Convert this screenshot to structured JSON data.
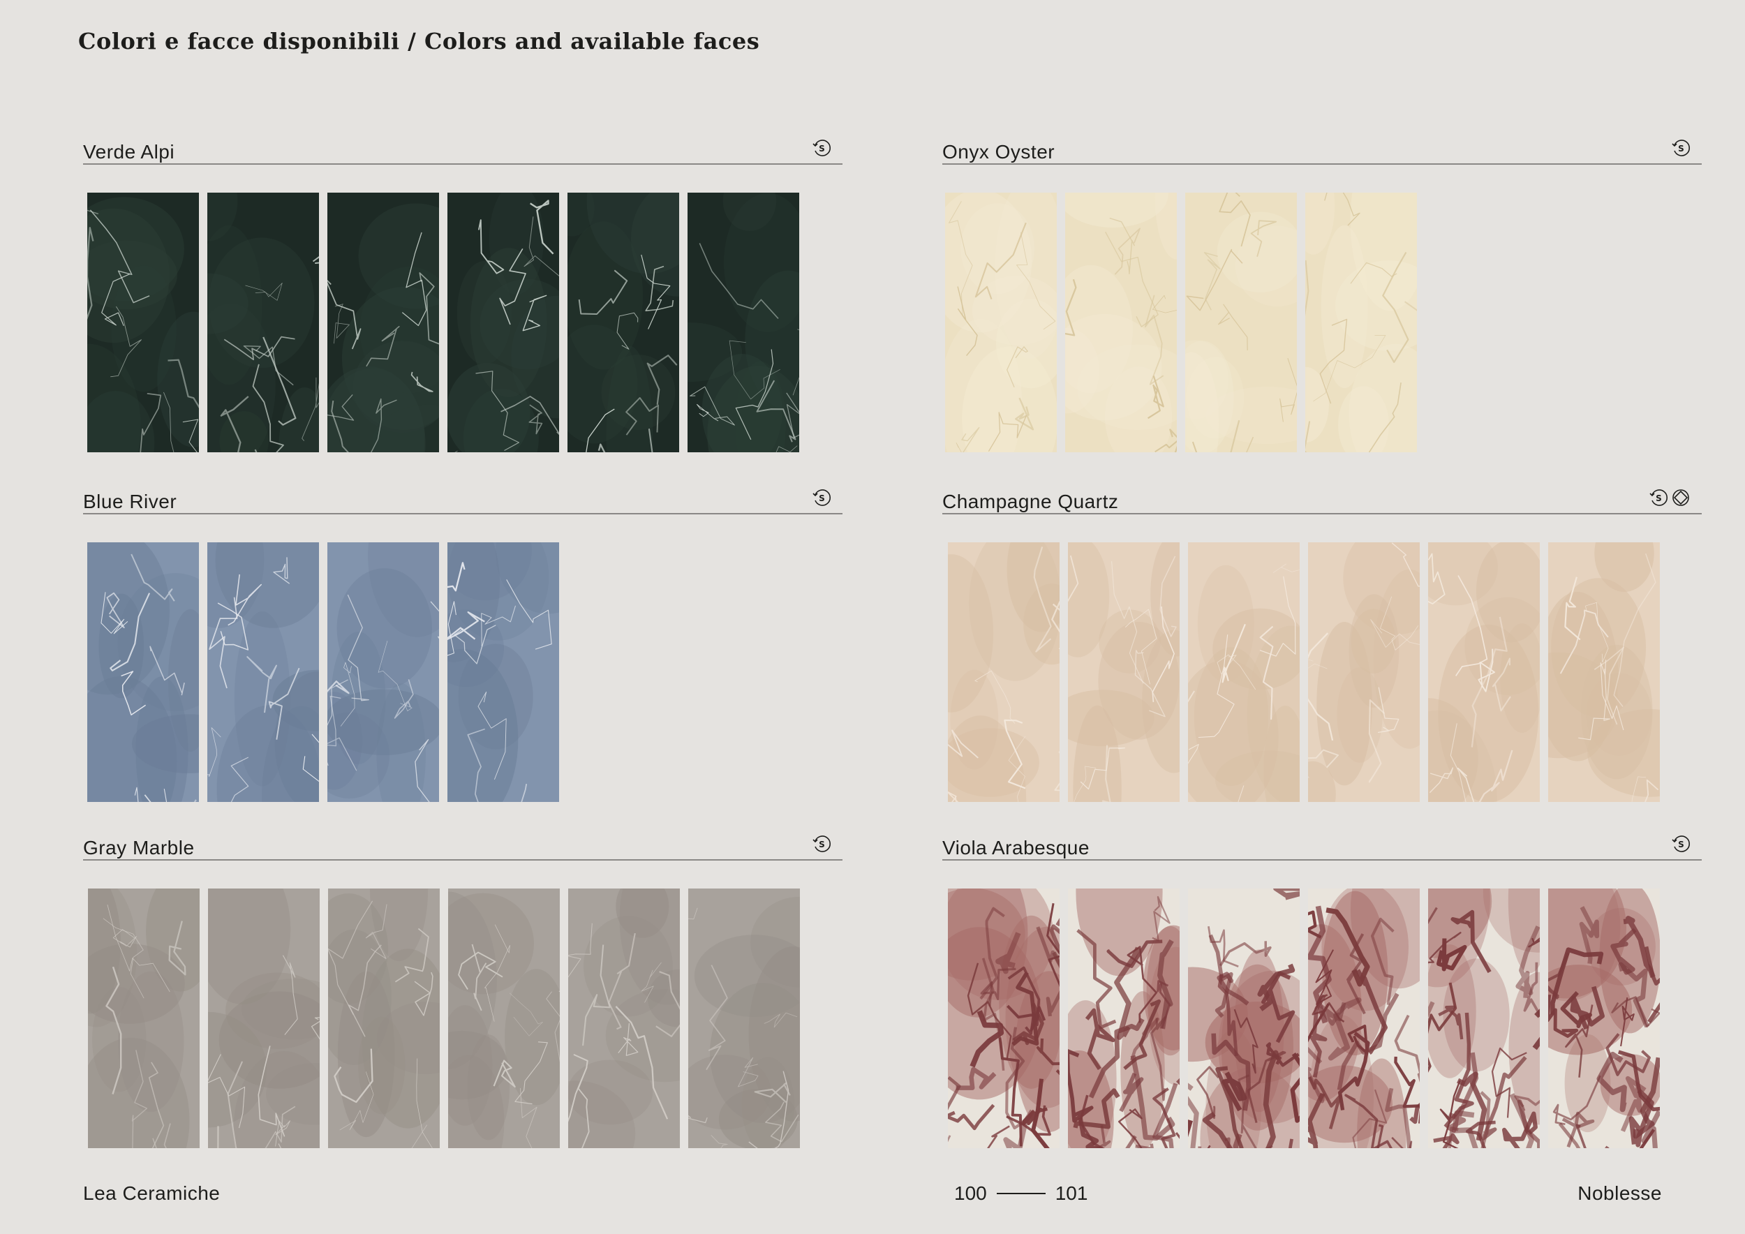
{
  "page": {
    "title": "Colori e facce disponibili / Colors and available faces"
  },
  "sections": [
    {
      "name": "Verde Alpi",
      "icons": [
        "faces-s-icon"
      ],
      "faces": 6,
      "colors": {
        "base": "#1d2a25",
        "vein": "#c9d3cc",
        "mid": "#2c3e36"
      }
    },
    {
      "name": "Onyx Oyster",
      "icons": [
        "faces-s-icon"
      ],
      "faces": 4,
      "colors": {
        "base": "#ece0c2",
        "vein": "#d6c49a",
        "mid": "#f3ead3"
      }
    },
    {
      "name": "Blue River",
      "icons": [
        "faces-s-icon"
      ],
      "faces": 4,
      "colors": {
        "base": "#8294ad",
        "vein": "#e9ecf1",
        "mid": "#6b7d97"
      }
    },
    {
      "name": "Champagne Quartz",
      "icons": [
        "faces-s-icon",
        "bookmatch-icon"
      ],
      "faces": 6,
      "colors": {
        "base": "#e6d3bf",
        "vein": "#f3e8dc",
        "mid": "#d7bea3"
      }
    },
    {
      "name": "Gray Marble",
      "icons": [
        "faces-s-icon"
      ],
      "faces": 6,
      "colors": {
        "base": "#a8a29c",
        "vein": "#cfcac4",
        "mid": "#948d86"
      }
    },
    {
      "name": "Viola Arabesque",
      "icons": [
        "faces-s-icon"
      ],
      "faces": 6,
      "colors": {
        "base": "#e9e4dc",
        "vein": "#7a3a3c",
        "mid": "#a66a66"
      }
    }
  ],
  "footer": {
    "brand": "Lea  Ceramiche",
    "page_left": "100",
    "page_right": "101",
    "collection": "Noblesse"
  }
}
